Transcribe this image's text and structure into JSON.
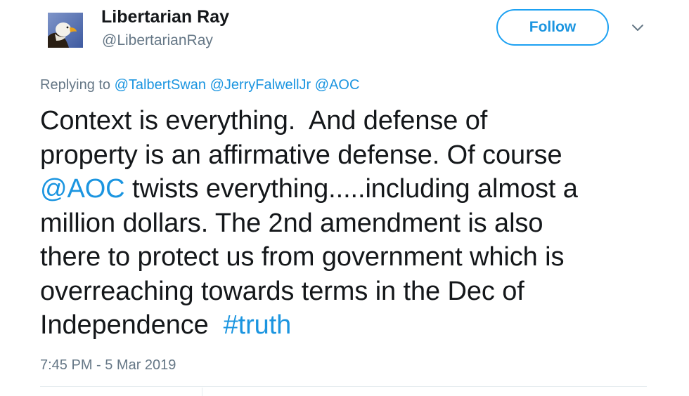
{
  "user": {
    "display_name": "Libertarian Ray",
    "handle": "@LibertarianRay"
  },
  "follow_button": {
    "label": "Follow"
  },
  "menu_icon": "chevron-down-icon",
  "reply_context": {
    "prefix": "Replying to",
    "mentions": [
      "@TalbertSwan",
      "@JerryFalwellJr",
      "@AOC"
    ]
  },
  "tweet": {
    "lines": [
      [
        {
          "text": "Context is everything.  And defense of",
          "link": false
        }
      ],
      [
        {
          "text": "property is an affirmative defense. Of course",
          "link": false
        }
      ],
      [
        {
          "text": "@AOC",
          "link": true
        },
        {
          "text": " twists everything.....including almost a",
          "link": false
        }
      ],
      [
        {
          "text": "million dollars. The 2nd amendment is also",
          "link": false
        }
      ],
      [
        {
          "text": "there to protect us from government which is",
          "link": false
        }
      ],
      [
        {
          "text": "overreaching towards terms in the Dec of",
          "link": false
        }
      ],
      [
        {
          "text": "Independence  ",
          "link": false
        },
        {
          "text": "#truth",
          "link": true
        }
      ]
    ]
  },
  "timestamp": "7:45 PM - 5 Mar 2019",
  "colors": {
    "link": "#1b95e0",
    "secondary_text": "#657786",
    "primary_text": "#14171a",
    "follow_border": "#1da1f2"
  }
}
